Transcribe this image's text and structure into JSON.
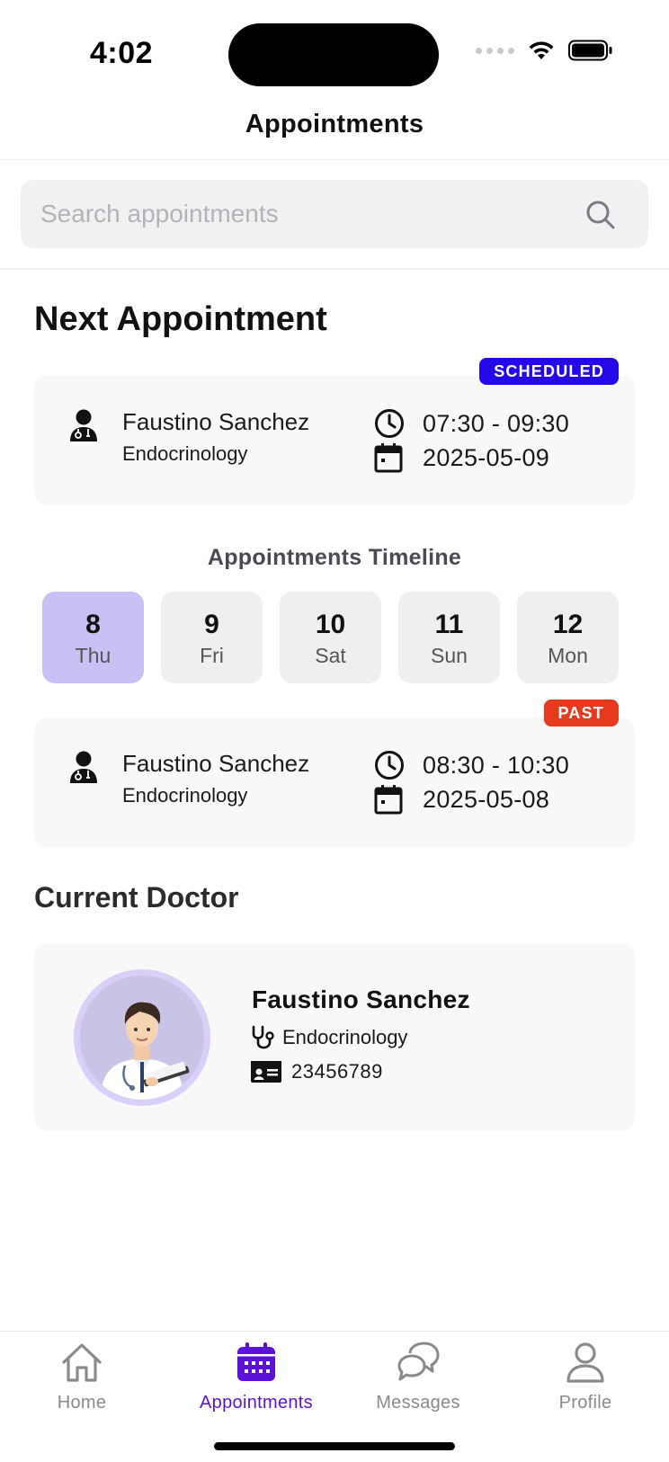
{
  "status_bar": {
    "time": "4:02"
  },
  "header": {
    "title": "Appointments"
  },
  "search": {
    "placeholder": "Search appointments",
    "value": ""
  },
  "next_appointment": {
    "heading": "Next Appointment",
    "status": "SCHEDULED",
    "doctor_name": "Faustino Sanchez",
    "specialty": "Endocrinology",
    "time": "07:30 - 09:30",
    "date": "2025-05-09"
  },
  "timeline": {
    "title": "Appointments Timeline",
    "days": [
      {
        "num": "8",
        "name": "Thu",
        "selected": true
      },
      {
        "num": "9",
        "name": "Fri",
        "selected": false
      },
      {
        "num": "10",
        "name": "Sat",
        "selected": false
      },
      {
        "num": "11",
        "name": "Sun",
        "selected": false
      },
      {
        "num": "12",
        "name": "Mon",
        "selected": false
      }
    ]
  },
  "timeline_appointment": {
    "status": "PAST",
    "doctor_name": "Faustino Sanchez",
    "specialty": "Endocrinology",
    "time": "08:30 - 10:30",
    "date": "2025-05-08"
  },
  "current_doctor": {
    "heading": "Current Doctor",
    "name": "Faustino Sanchez",
    "specialty": "Endocrinology",
    "id": "23456789"
  },
  "tabs": [
    {
      "label": "Home",
      "icon": "home-icon",
      "active": false
    },
    {
      "label": "Appointments",
      "icon": "calendar-icon",
      "active": true
    },
    {
      "label": "Messages",
      "icon": "chat-bubbles-icon",
      "active": false
    },
    {
      "label": "Profile",
      "icon": "person-icon",
      "active": false
    }
  ],
  "colors": {
    "accent": "#5b12d6",
    "scheduled_badge": "#2408e8",
    "past_badge": "#e63a1f",
    "selected_day": "#cbc0f3"
  }
}
